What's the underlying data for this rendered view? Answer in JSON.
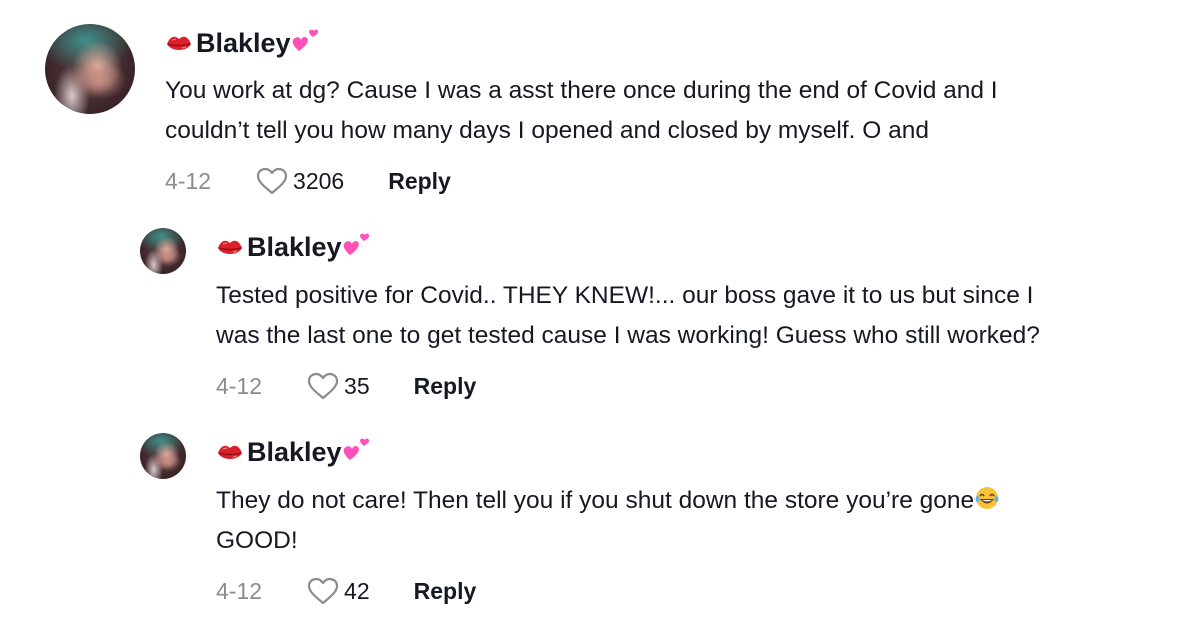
{
  "comments": [
    {
      "author": "Blakley",
      "author_prefix_icon": "kiss-mark-icon",
      "author_suffix_icon": "two-hearts-icon",
      "lines": [
        "You work at dg? Cause I was a asst there once during the end of Covid and I",
        "couldn’t tell you how many days I opened and closed by myself. O and"
      ],
      "date": "4-12",
      "likes": "3206",
      "reply_label": "Reply",
      "is_reply": false
    },
    {
      "author": "Blakley",
      "author_prefix_icon": "kiss-mark-icon",
      "author_suffix_icon": "two-hearts-icon",
      "lines": [
        "Tested positive for Covid.. THEY KNEW!... our boss gave it to us but since I",
        "was the last one to get tested cause I was working! Guess who still worked?"
      ],
      "date": "4-12",
      "likes": "35",
      "reply_label": "Reply",
      "is_reply": true
    },
    {
      "author": "Blakley",
      "author_prefix_icon": "kiss-mark-icon",
      "author_suffix_icon": "two-hearts-icon",
      "lines": [
        "They do not care! Then tell you if you shut down the store you’re gone",
        "GOOD!"
      ],
      "line_end_emoji": "face-with-tears-of-joy-icon",
      "date": "4-12",
      "likes": "42",
      "reply_label": "Reply",
      "is_reply": true
    }
  ],
  "colors": {
    "text": "#161823",
    "muted": "#8a8b91",
    "heart_outline": "#8a8b91",
    "lips": "#d9202b",
    "hearts": "#ff4fb8"
  }
}
